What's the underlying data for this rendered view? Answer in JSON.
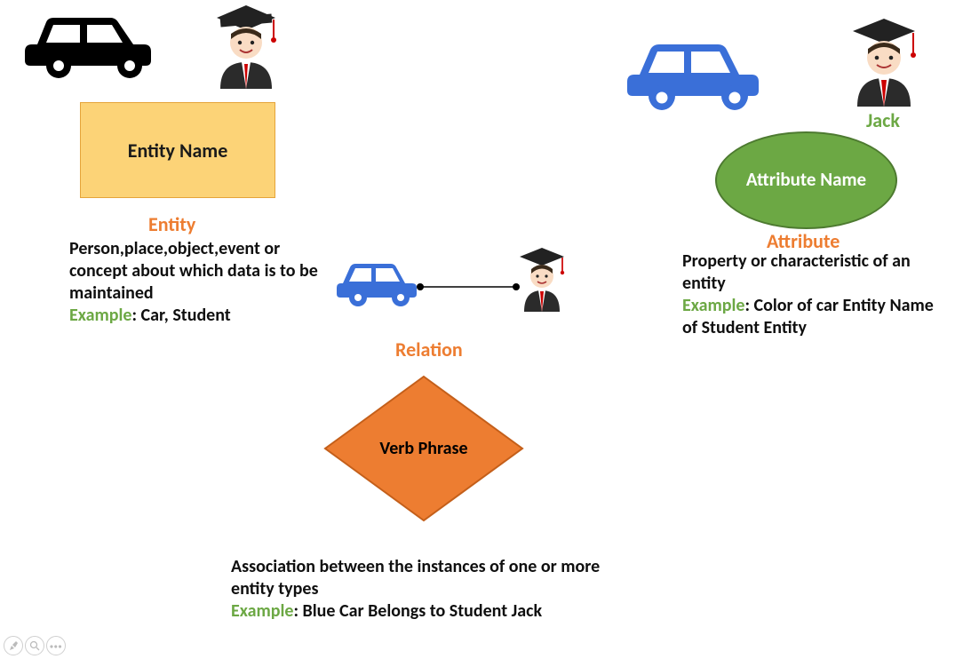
{
  "entity": {
    "box_label": "Entity Name",
    "title": "Entity",
    "desc": "Person,place,object,event or concept about which data is to be maintained",
    "example_label": "Example",
    "example_text": ": Car, Student"
  },
  "attribute": {
    "jack_label": "Jack",
    "ellipse_label": "Attribute Name",
    "title": "Attribute",
    "desc": "Property or characteristic of an entity",
    "example_label": "Example",
    "example_text": ": Color of car Entity Name of Student Entity"
  },
  "relation": {
    "title": "Relation",
    "diamond_label": "Verb Phrase",
    "desc": "Association between the instances of one or more entity types",
    "example_label": "Example",
    "example_text": ": Blue Car Belongs to Student Jack"
  },
  "icons": {
    "car_black": "car-icon",
    "car_blue": "car-icon",
    "student": "student-icon"
  },
  "toolbar": {
    "pen": "pen",
    "zoom": "zoom",
    "more": "more"
  }
}
